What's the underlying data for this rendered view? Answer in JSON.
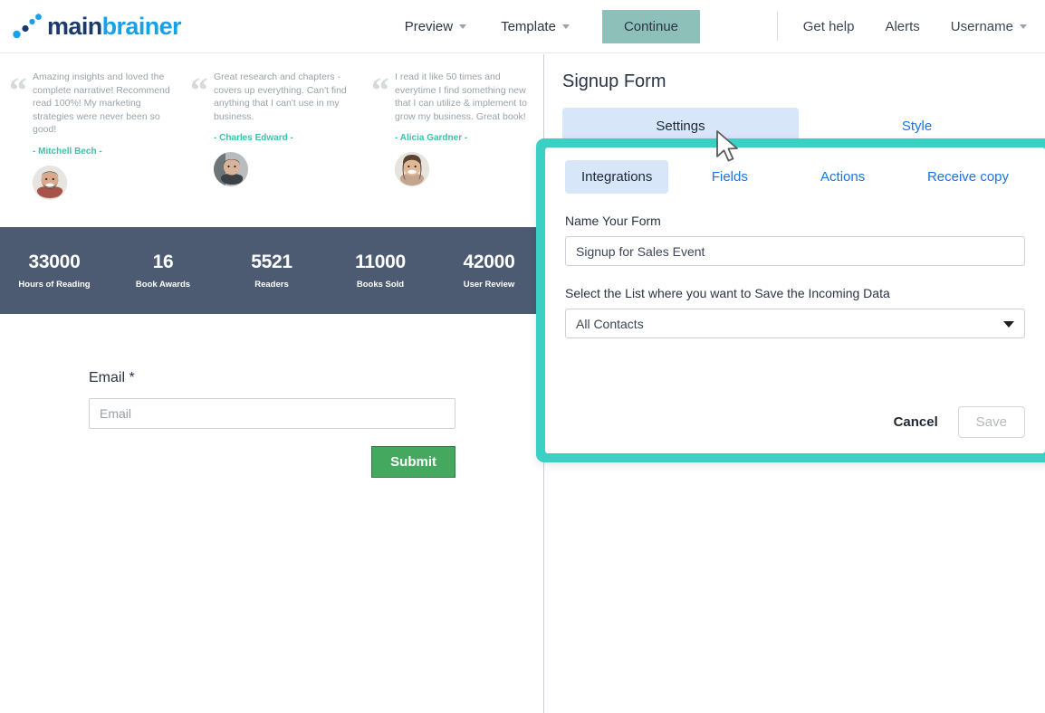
{
  "topnav": {
    "logo": {
      "main": "main",
      "brainer": "brainer"
    },
    "center_links": [
      {
        "label": "Preview",
        "has_caret": true
      },
      {
        "label": "Template",
        "has_caret": true
      }
    ],
    "continue_label": "Continue",
    "right_links": [
      {
        "label": "Get help",
        "has_caret": false
      },
      {
        "label": "Alerts",
        "has_caret": false
      },
      {
        "label": "Username",
        "has_caret": true
      }
    ]
  },
  "preview": {
    "testimonials": [
      {
        "text": "Amazing insights and loved the complete narrative! Recommend read 100%! My marketing strategies were never been so good!",
        "author": "- Mitchell Bech -"
      },
      {
        "text": "Great research and chapters - covers up everything. Can't find anything that I can't use in my business.",
        "author": "- Charles Edward -"
      },
      {
        "text": "I read it like 50 times and everytime I find something new that I can utilize & implement to grow my business. Great book!",
        "author": "- Alicia Gardner -"
      }
    ],
    "stats": [
      {
        "value": "33000",
        "label": "Hours of Reading"
      },
      {
        "value": "16",
        "label": "Book Awards"
      },
      {
        "value": "5521",
        "label": "Readers"
      },
      {
        "value": "11000",
        "label": "Books Sold"
      },
      {
        "value": "42000",
        "label": "User Review"
      }
    ],
    "form": {
      "email_label": "Email",
      "required_mark": "*",
      "email_placeholder": "Email",
      "email_value": "",
      "submit_label": "Submit"
    }
  },
  "panel": {
    "title": "Signup Form",
    "tabs": [
      {
        "label": "Settings",
        "active": true
      },
      {
        "label": "Style",
        "active": false
      }
    ]
  },
  "modal": {
    "tabs": [
      {
        "label": "Integrations",
        "active": true
      },
      {
        "label": "Fields",
        "active": false
      },
      {
        "label": "Actions",
        "active": false
      },
      {
        "label": "Receive copy",
        "active": false
      }
    ],
    "name_label": "Name Your Form",
    "name_value": "Signup for Sales Event",
    "list_label": "Select the List where you want to Save the Incoming Data",
    "list_value": "All Contacts",
    "cancel_label": "Cancel",
    "save_label": "Save"
  },
  "colors": {
    "modal_border": "#3ad0c4",
    "accent_blue": "#1a73e8",
    "tab_active_bg": "#d7e6f9",
    "continue_btn": "#8dc0b9",
    "submit_green": "#44a85e",
    "stats_bg": "#4d5b72",
    "author_teal": "#3ac4a8",
    "logo_dark": "#1b3a6b",
    "logo_light": "#18a0e8"
  }
}
